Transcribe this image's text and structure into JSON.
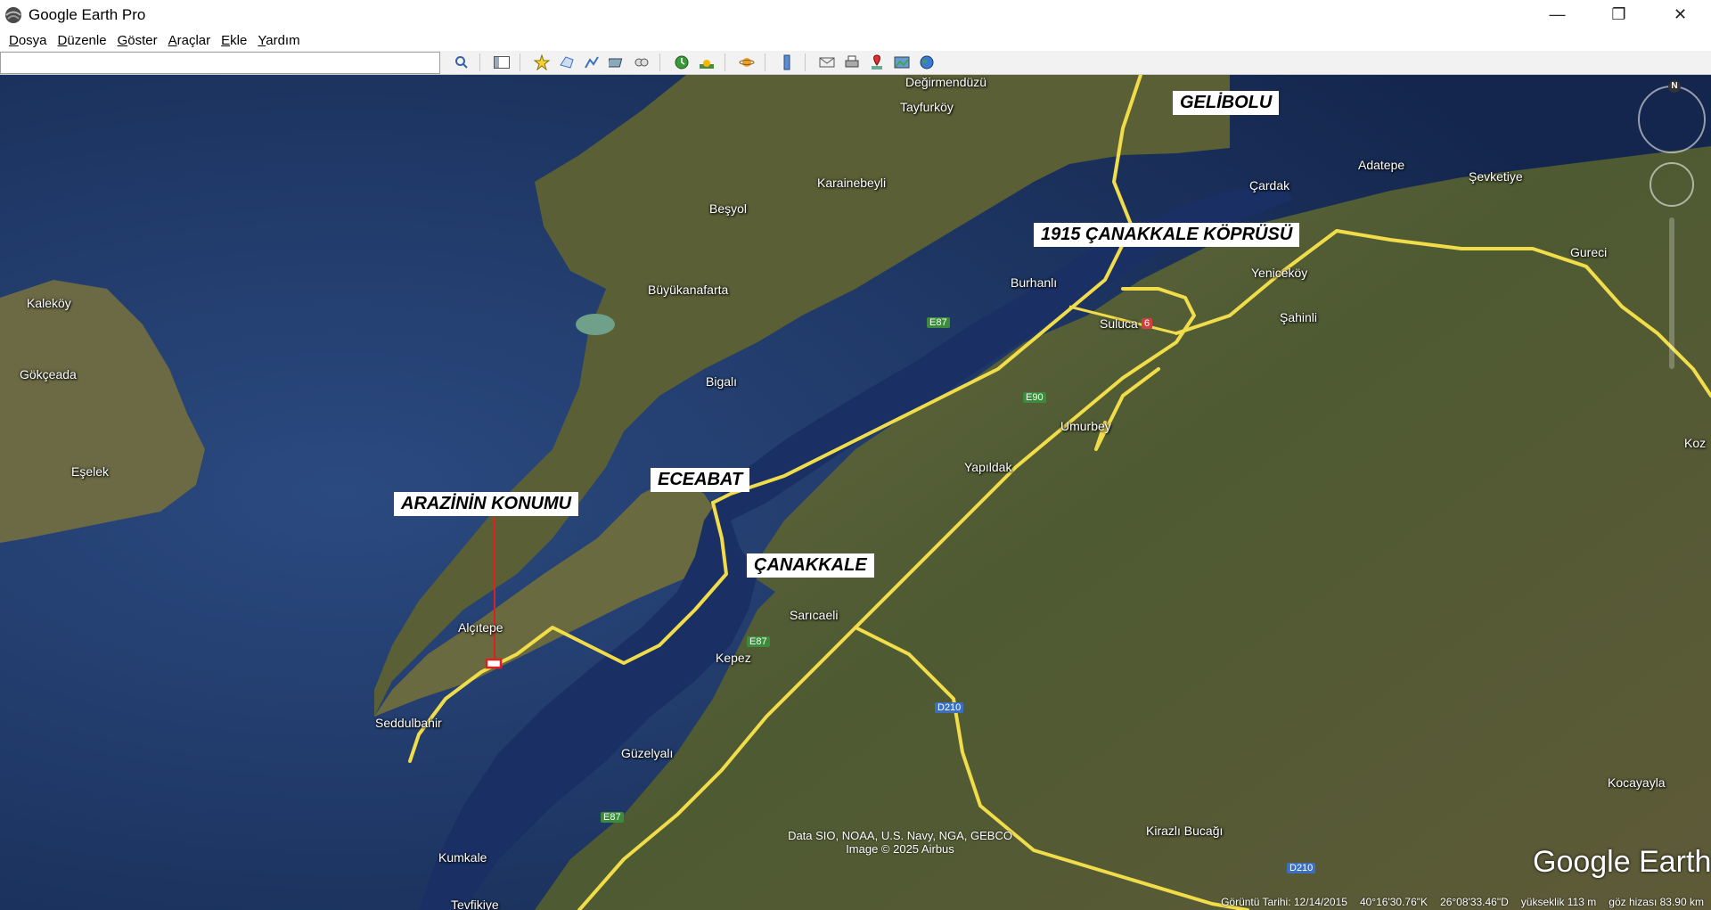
{
  "window": {
    "title": "Google Earth Pro",
    "controls": {
      "minimize": "—",
      "maximize": "❐",
      "close": "✕"
    }
  },
  "menu": [
    {
      "label": "Dosya",
      "key": "D",
      "rest": "osya"
    },
    {
      "label": "Düzenle",
      "key": "D",
      "rest": "üzenle"
    },
    {
      "label": "Göster",
      "key": "G",
      "rest": "öster"
    },
    {
      "label": "Araçlar",
      "key": "A",
      "rest": "raçlar"
    },
    {
      "label": "Ekle",
      "key": "E",
      "rest": "kle"
    },
    {
      "label": "Yardım",
      "key": "Y",
      "rest": "ardım"
    }
  ],
  "search": {
    "value": "",
    "placeholder": ""
  },
  "toolbar": {
    "icons": [
      "search-icon",
      "sidebar-toggle-icon",
      "add-placemark-icon",
      "add-polygon-icon",
      "add-path-icon",
      "add-overlay-icon",
      "record-tour-icon",
      "historical-imagery-icon",
      "sunlight-icon",
      "planets-icon",
      "ruler-icon",
      "email-icon",
      "print-icon",
      "save-image-icon",
      "view-in-maps-icon",
      "earth-icon"
    ]
  },
  "map": {
    "places": {
      "degirmendüzü": "Değirmendüzü",
      "tayfurkoy": "Tayfurköy",
      "karainebeyli": "Karainebeyli",
      "besyol": "Beşyol",
      "buyukanafarta": "Büyükanafarta",
      "bigali": "Bigalı",
      "burhanli": "Burhanlı",
      "cardak": "Çardak",
      "adatepe": "Adatepe",
      "sevketiye": "Şevketiye",
      "yenicekoy": "Yeniceköy",
      "sahinli": "Şahinli",
      "gureci": "Gureci",
      "suluca": "Suluca",
      "umurbey": "Umurbey",
      "yapildak": "Yapıldak",
      "kozl": "Koz",
      "kalekoy": "Kaleköy",
      "gokceada": "Gökçeada",
      "eselek": "Eşelek",
      "alcitepe": "Alçıtepe",
      "seddulbahir": "Seddulbahir",
      "saricaeli": "Sarıcaeli",
      "kepez": "Kepez",
      "guzelyali": "Güzelyalı",
      "kumkale": "Kumkale",
      "tevfikiye": "Tevfikiye",
      "kirazli": "Kirazlı Bucağı",
      "kocayayla": "Kocayayla"
    },
    "callouts": {
      "gelibolu": "GELİBOLU",
      "bridge": "1915 ÇANAKKALE KÖPRÜSÜ",
      "eceabat": "ECEABAT",
      "canakkale": "ÇANAKKALE",
      "arazi": "ARAZİNİN KONUMU"
    },
    "shields": {
      "e87_north": "E87",
      "e87_kepez": "E87",
      "e87_south": "E87",
      "e90": "E90",
      "d210_a": "D210",
      "d210_b": "D210",
      "e6": "6"
    },
    "attribution": {
      "line1": "Data SIO, NOAA, U.S. Navy, NGA, GEBCO",
      "line2": "Image © 2025 Airbus"
    },
    "logo": "Google Earth",
    "compass_n": "N",
    "colors": {
      "sea": "#1a2e58",
      "land": "#6b6a3e",
      "road": "#f1dc4a",
      "marker": "#e02020"
    }
  },
  "status": {
    "date": "Görüntü Tarihi: 12/14/2015",
    "lat": "40°16'30.76\"K",
    "lon": "26°08'33.46\"D",
    "elev": "yükseklik   113 m",
    "eye": "göz hizası   83.90 km"
  }
}
